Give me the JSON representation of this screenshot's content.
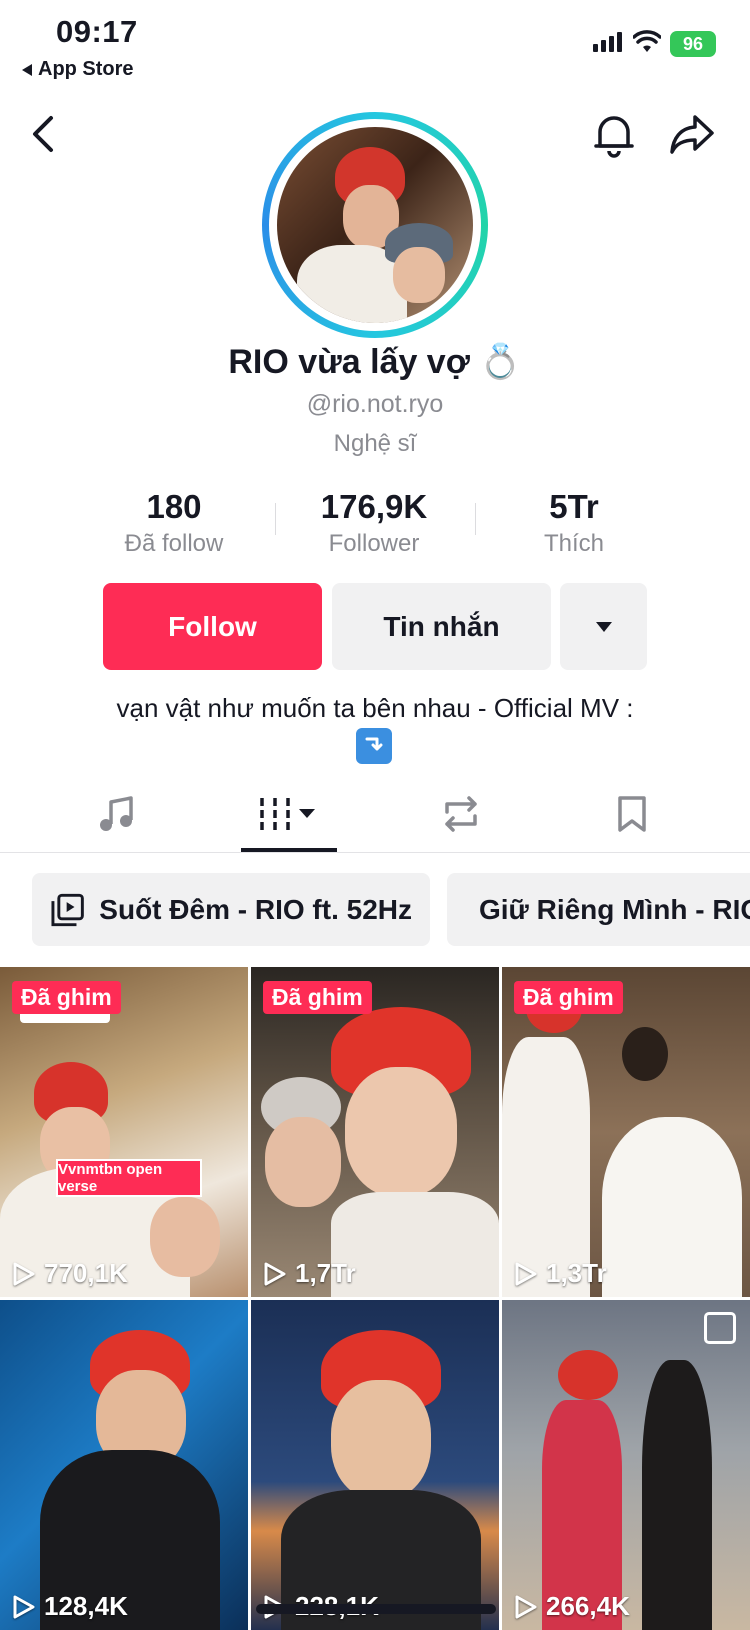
{
  "status_bar": {
    "time": "09:17",
    "back_app": "App Store",
    "battery": "96"
  },
  "profile": {
    "display_name": "RIO vừa lấy vợ 💍",
    "username": "@rio.not.ryo",
    "category": "Nghệ sĩ",
    "stats": [
      {
        "value": "180",
        "label": "Đã follow"
      },
      {
        "value": "176,9K",
        "label": "Follower"
      },
      {
        "value": "5Tr",
        "label": "Thích"
      }
    ],
    "bio": "vạn vật như muốn ta bên nhau - Official MV :"
  },
  "actions": {
    "follow": "Follow",
    "message": "Tin nhắn"
  },
  "tabs": [
    "music-icon",
    "grid-icon",
    "repost-icon",
    "bookmark-icon"
  ],
  "playlists": [
    {
      "label": "Suốt Đêm - RIO ft. 52Hz"
    },
    {
      "label": "Giữ Riêng Mình - RIO"
    }
  ],
  "videos": [
    {
      "pinned": "Đã ghim",
      "views": "770,1K",
      "overlay": "Vvnmtbn open verse"
    },
    {
      "pinned": "Đã ghim",
      "views": "1,7Tr",
      "overlay": ""
    },
    {
      "pinned": "Đã ghim",
      "views": "1,3Tr",
      "overlay": ""
    },
    {
      "pinned": "",
      "views": "128,4K",
      "overlay": ""
    },
    {
      "pinned": "",
      "views": "228,1K",
      "overlay": ""
    },
    {
      "pinned": "",
      "views": "266,4K",
      "overlay": ""
    }
  ],
  "colors": {
    "follow": "#fe2c55",
    "ring": "#25c7e0",
    "battery": "#34c759"
  }
}
